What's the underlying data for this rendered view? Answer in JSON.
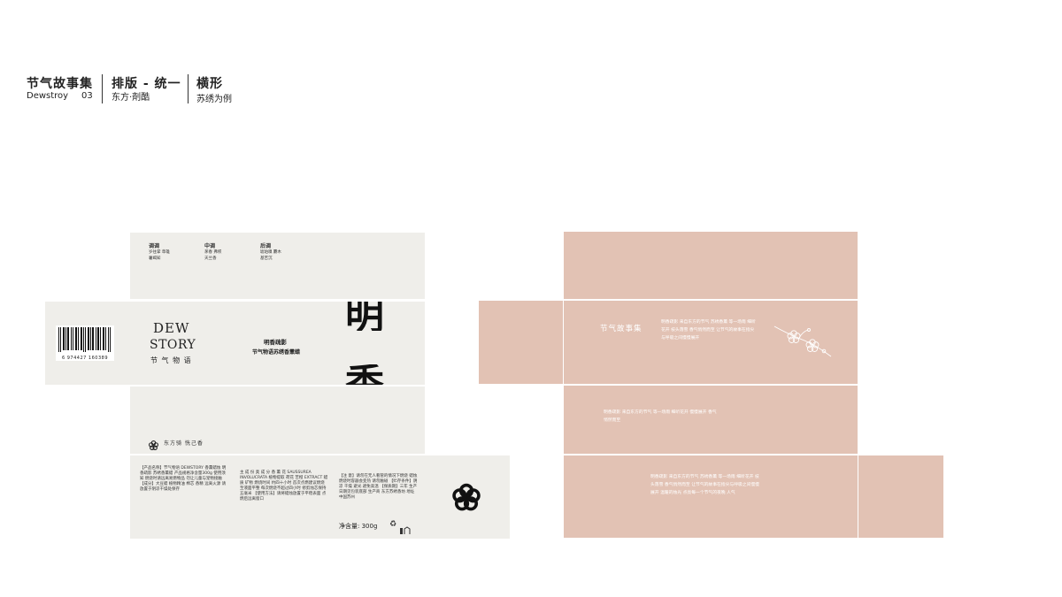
{
  "header": {
    "series_title": "节气故事集",
    "series_en": "Dewstroy",
    "page_no": "03",
    "section_title": "排版 - 统一",
    "section_sub": "东方·剤酷",
    "topic_title": "横形",
    "topic_sub": "苏绣为例"
  },
  "box_left": {
    "notes_top": {
      "col1_title": "调调",
      "col1_line1": "岁往掌 草雄",
      "col1_line2": "薯竭知",
      "col2_title": "中调",
      "col2_line1": "茅春 弗积",
      "col2_line2": "天兰香",
      "col3_title": "后调",
      "col3_line1": "琥珀嗅 麝木",
      "col3_line2": "基苦沉"
    },
    "barcode_number": "6 974427 160389",
    "brand_line1": "DEW",
    "brand_line2": "STORY",
    "brand_cn": "节 气 物 语",
    "product_line1": "明香疏影",
    "product_line2": "节气物语苏绣香薰蜡",
    "big_char_1": "明",
    "big_char_2": "香",
    "series_name": "东方骑  恍己香",
    "info_col1": "【产品名称】节气物语 DEWSTORY 香薰蜡烛 明香疏影 苏绣香薰蜡 产品规格净含量300g 使用须知 燃烧时请远离易燃物品 勿让儿童与宠物接触 【成分】大豆蜡 植物精油 棉芯 香精 远离火源 请放置于阴凉干燥处保存",
    "info_col2": "主 成 份 奥 成 分 香 薰 花 SAUSSUREA INVOLUCRATA 植物提取 荷花 苦橙 EXTRACT 蜡质 矿物 燃烧时间 约四十小时 首次点燃建议燃烧至液面平整 每次燃烧不超过四小时 修剪烛芯保持五毫米 【使用方法】请将蜡烛放置于平稳表面 点燃后远离窗口",
    "info_col3": "【注 意】请勿在无人看管的情况下燃烧 蜡烛燃烧时容器会变热 请勿触碰 【贮存条件】阴凉 干燥 避光 避免高温 【保质期】三年 生产日期见包装底部 生产商 东方苏绣香坊 地址 中国苏州",
    "net_weight": "净含量: 300g"
  },
  "box_right": {
    "brand_title": "节气故事集",
    "text_block_1": "明香疏影 来自东方的节气 苏绣香薰 等一场雨 细听花开 枝头落雪 香气悄然而至 让节气的故事在指尖与呼吸之间慢慢展开",
    "text_block_2": "明香疏影 来自东方的节气 等一场雨 细听花开 慢慢展开 香气悄然而至",
    "text_block_3": "明香疏影 来自东方的节气 苏绣香薰 等一场雨 细听花开 枝头落雪 香气悄然而至 让节气的故事在指尖与呼吸之间慢慢展开 温暖的烛光 点亮每一个节气的夜晚 人气"
  },
  "colors": {
    "panel_light": "#efeeea",
    "panel_pink": "#e2c2b4",
    "text_dark": "#222222"
  }
}
